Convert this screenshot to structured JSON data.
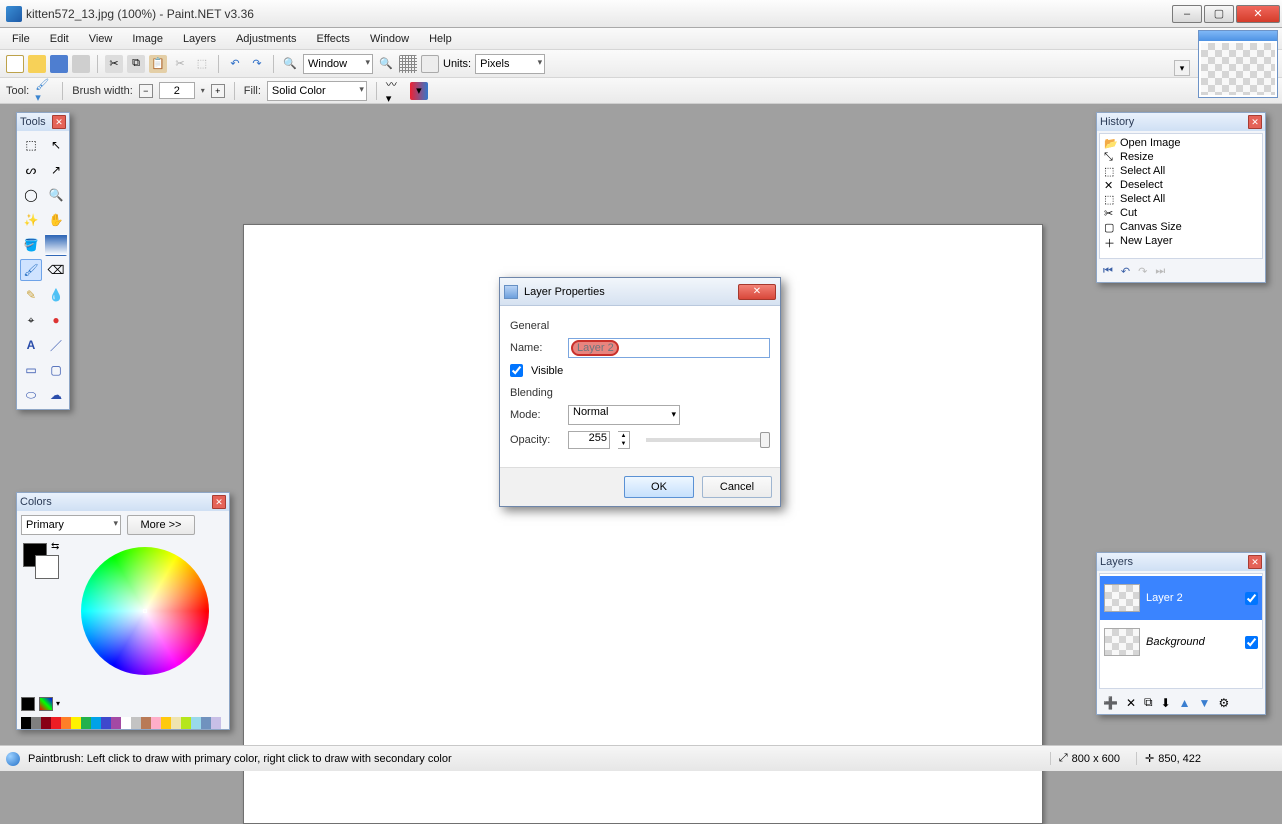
{
  "titlebar": {
    "text": "kitten572_13.jpg (100%) - Paint.NET v3.36"
  },
  "winbtns": {
    "min": "–",
    "max": "▢",
    "close": "✕"
  },
  "menu": [
    "File",
    "Edit",
    "View",
    "Image",
    "Layers",
    "Adjustments",
    "Effects",
    "Window",
    "Help"
  ],
  "tb1": {
    "window_label": "Window",
    "units_label": "Units:",
    "units_value": "Pixels"
  },
  "tb2": {
    "tool_label": "Tool:",
    "brush_label": "Brush width:",
    "brush_value": "2",
    "fill_label": "Fill:",
    "fill_value": "Solid Color"
  },
  "tools": {
    "title": "Tools",
    "items": [
      "rect-select",
      "move",
      "lasso",
      "move-sel",
      "ellipse-select",
      "zoom",
      "wand",
      "pan",
      "brush",
      "bucket",
      "pencil",
      "eraser",
      "clone",
      "recolor",
      "colorpick",
      "text",
      "line",
      "rect",
      "round-rect",
      "ellipse",
      "freeform"
    ]
  },
  "history": {
    "title": "History",
    "items": [
      "Open Image",
      "Resize",
      "Select All",
      "Deselect",
      "Select All",
      "Cut",
      "Canvas Size",
      "New Layer"
    ]
  },
  "layers": {
    "title": "Layers",
    "rows": [
      {
        "name": "Layer 2",
        "visible": true,
        "selected": true,
        "itstyle": "normal"
      },
      {
        "name": "Background",
        "visible": true,
        "selected": false,
        "itstyle": "italic"
      }
    ]
  },
  "colors": {
    "title": "Colors",
    "dd": "Primary",
    "more": "More >>",
    "palette": [
      "#000000",
      "#7f7f7f",
      "#880015",
      "#ed1c24",
      "#ff7f27",
      "#fff200",
      "#22b14c",
      "#00a2e8",
      "#3f48cc",
      "#a349a4",
      "#ffffff",
      "#c3c3c3",
      "#b97a57",
      "#ffaec9",
      "#ffc90e",
      "#efe4b0",
      "#b5e61d",
      "#99d9ea",
      "#7092be",
      "#c8bfe7"
    ]
  },
  "dialog": {
    "title": "Layer Properties",
    "general_lbl": "General",
    "name_lbl": "Name:",
    "name_value": "Layer 2",
    "visible_lbl": "Visible",
    "visible_checked": true,
    "blending_lbl": "Blending",
    "mode_lbl": "Mode:",
    "mode_value": "Normal",
    "opacity_lbl": "Opacity:",
    "opacity_value": "255",
    "ok": "OK",
    "cancel": "Cancel"
  },
  "status": {
    "tip": "Paintbrush: Left click to draw with primary color, right click to draw with secondary color",
    "size": "800 x 600",
    "coord": "850, 422"
  }
}
